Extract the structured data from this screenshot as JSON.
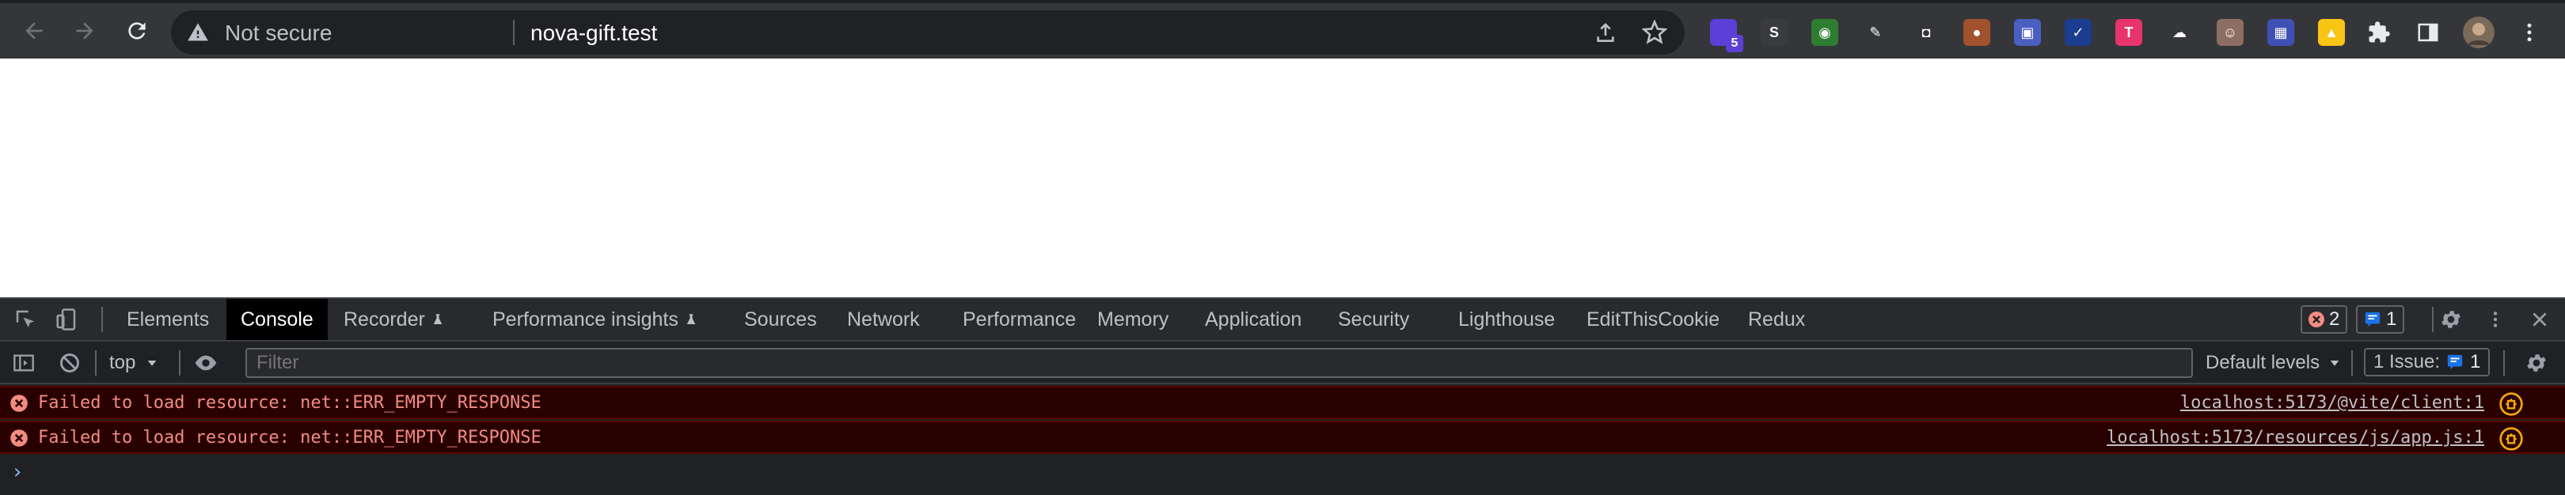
{
  "browser": {
    "security_label": "Not secure",
    "url": "nova-gift.test",
    "extensions": [
      {
        "name": "extension-purple",
        "color": "#5b3fd6",
        "badge": "5"
      },
      {
        "name": "extension-s",
        "color": "#3a3b3f",
        "glyph": "S"
      },
      {
        "name": "extension-globe",
        "color": "#2e7d32",
        "glyph": "◉"
      },
      {
        "name": "extension-pen",
        "color": "#35363a",
        "glyph": "✎"
      },
      {
        "name": "extension-camera",
        "color": "#35363a",
        "glyph": "◘"
      },
      {
        "name": "extension-cookie",
        "color": "#a0522d",
        "glyph": "●"
      },
      {
        "name": "extension-window",
        "color": "#4a5fc1",
        "glyph": "▣"
      },
      {
        "name": "extension-check",
        "color": "#1a3d8f",
        "glyph": "✓"
      },
      {
        "name": "extension-t",
        "color": "#e8336d",
        "glyph": "T"
      },
      {
        "name": "extension-cloud",
        "color": "#35363a",
        "glyph": "☁"
      },
      {
        "name": "extension-face",
        "color": "#8d6e63",
        "glyph": "☺"
      },
      {
        "name": "extension-grid",
        "color": "#3f51b5",
        "glyph": "▦"
      },
      {
        "name": "extension-yellow",
        "color": "#f9c513",
        "glyph": "▲"
      }
    ]
  },
  "devtools": {
    "tabs": [
      {
        "label": "Elements",
        "experimental": false
      },
      {
        "label": "Console",
        "experimental": false,
        "active": true
      },
      {
        "label": "Recorder",
        "experimental": true
      },
      {
        "label": "Performance insights",
        "experimental": true
      },
      {
        "label": "Sources",
        "experimental": false
      },
      {
        "label": "Network",
        "experimental": false
      },
      {
        "label": "Performance",
        "experimental": false
      },
      {
        "label": "Memory",
        "experimental": false
      },
      {
        "label": "Application",
        "experimental": false
      },
      {
        "label": "Security",
        "experimental": false
      },
      {
        "label": "Lighthouse",
        "experimental": false
      },
      {
        "label": "EditThisCookie",
        "experimental": false
      },
      {
        "label": "Redux",
        "experimental": false
      }
    ],
    "error_count": "2",
    "message_count": "1",
    "console": {
      "context": "top",
      "filter_placeholder": "Filter",
      "levels": "Default levels",
      "issues_label": "1 Issue:",
      "issues_count": "1"
    },
    "messages": [
      {
        "text": "Failed to load resource: net::ERR_EMPTY_RESPONSE",
        "source": "localhost:5173/@vite/client:1"
      },
      {
        "text": "Failed to load resource: net::ERR_EMPTY_RESPONSE",
        "source": "localhost:5173/resources/js/app.js:1"
      }
    ],
    "prompt": "›"
  },
  "colors": {
    "error_bg": "#290000",
    "error_text": "#f28b82",
    "accent_blue": "#1a73e8"
  }
}
